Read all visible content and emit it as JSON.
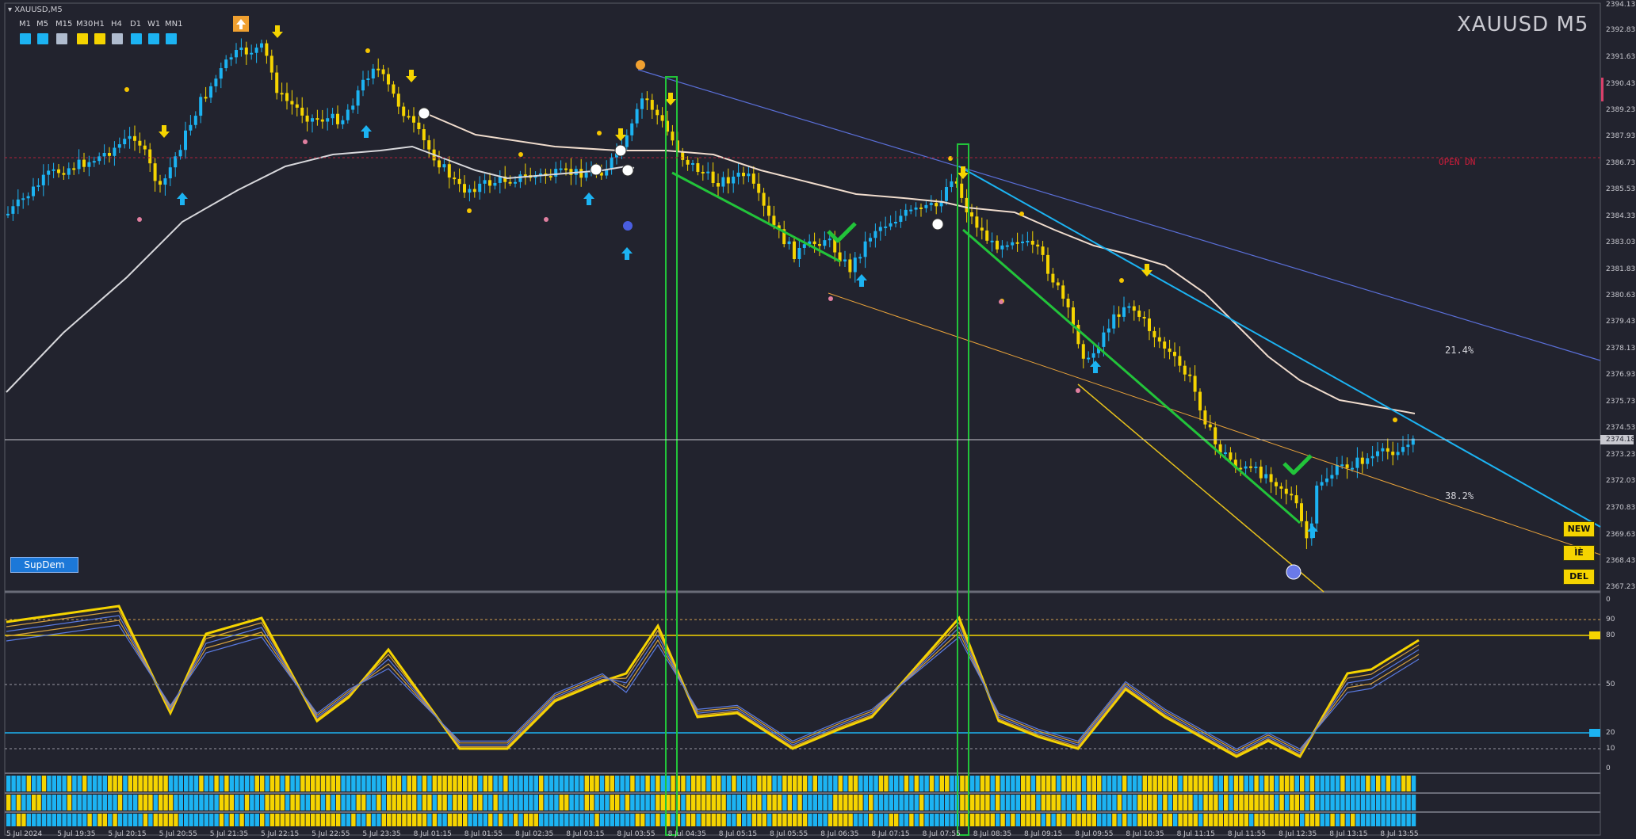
{
  "header": {
    "symbol_label": "XAUUSD,M5",
    "big_title": "XAUUSD   M5"
  },
  "timeframes": [
    {
      "label": "M1",
      "color": "#1cb3f2"
    },
    {
      "label": "M5",
      "color": "#1cb3f2"
    },
    {
      "label": "M15",
      "color": "#b0bccf"
    },
    {
      "label": "M30",
      "color": "#f5d400"
    },
    {
      "label": "H1",
      "color": "#f5d400"
    },
    {
      "label": "H4",
      "color": "#b0bccf"
    },
    {
      "label": "D1",
      "color": "#1cb3f2"
    },
    {
      "label": "W1",
      "color": "#1cb3f2"
    },
    {
      "label": "MN1",
      "color": "#1cb3f2"
    }
  ],
  "buttons": {
    "supdem": "SupDem",
    "new": "NEW",
    "ie": "ÌÈ",
    "del": "DEL"
  },
  "annotations": {
    "open_dn": "OPEN DN",
    "fib_214": "21.4%",
    "fib_382": "38.2%"
  },
  "price_axis": {
    "labels": [
      "2394.13",
      "2392.83",
      "2391.63",
      "2390.43",
      "2389.23",
      "2387.93",
      "2386.73",
      "2385.53",
      "2384.33",
      "2383.03",
      "2381.83",
      "2380.63",
      "2379.43",
      "2378.13",
      "2376.93",
      "2375.73",
      "2374.53",
      "2374.18",
      "2373.23",
      "2372.03",
      "2370.83",
      "2369.63",
      "2368.43",
      "2367.23"
    ],
    "current": "2374.18"
  },
  "osc_axis": {
    "labels": [
      "0",
      "90",
      "80",
      "50",
      "20",
      "10",
      "0"
    ]
  },
  "time_axis": {
    "labels": [
      "5 Jul 2024",
      "5 Jul 19:35",
      "5 Jul 20:15",
      "5 Jul 20:55",
      "5 Jul 21:35",
      "5 Jul 22:15",
      "5 Jul 22:55",
      "5 Jul 23:35",
      "8 Jul 01:15",
      "8 Jul 01:55",
      "8 Jul 02:35",
      "8 Jul 03:15",
      "8 Jul 03:55",
      "8 Jul 04:35",
      "8 Jul 05:15",
      "8 Jul 05:55",
      "8 Jul 06:35",
      "8 Jul 07:15",
      "8 Jul 07:55",
      "8 Jul 08:35",
      "8 Jul 09:15",
      "8 Jul 09:55",
      "8 Jul 10:35",
      "8 Jul 11:15",
      "8 Jul 11:55",
      "8 Jul 12:35",
      "8 Jul 13:15",
      "8 Jul 13:55"
    ]
  },
  "colors": {
    "background": "#22232e",
    "bull": "#1cb3f2",
    "bear": "#f5d400",
    "ma_slow": "#d8d8dc",
    "ma_fast": "#f0dccd",
    "green_box": "#22c43a",
    "trend_blue": "#1cb3f2",
    "trend_orange": "#e8a23a",
    "current_price_line": "#c9c9d0"
  }
}
